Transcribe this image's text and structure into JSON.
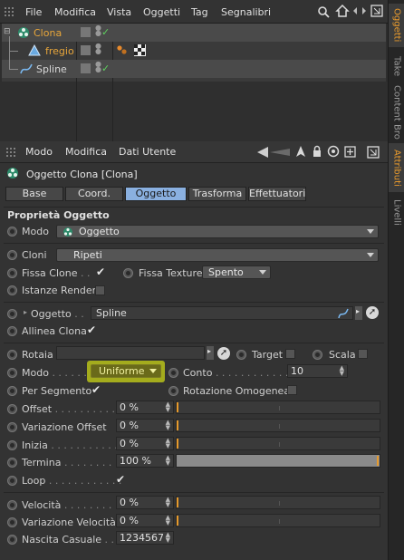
{
  "menubar": {
    "items": [
      "File",
      "Modifica",
      "Vista",
      "Oggetti",
      "Tag",
      "Segnalibri"
    ]
  },
  "objects": [
    {
      "name": "Clona",
      "color": "#e8a63a"
    },
    {
      "name": "fregio",
      "color": "#e8a63a"
    },
    {
      "name": "Spline",
      "color": "#d8d8d8"
    }
  ],
  "side_tabs": [
    "Oggetti",
    "Take",
    "Content Bro",
    "Attributi",
    "Livelli"
  ],
  "attr_menu": {
    "items": [
      "Modo",
      "Modifica",
      "Dati Utente"
    ]
  },
  "object_title": "Oggetto Clona [Clona]",
  "tabs": [
    "Base",
    "Coord.",
    "Oggetto",
    "Trasforma",
    "Effettuatori"
  ],
  "section_title": "Proprietà Oggetto",
  "props": {
    "modo_label": "Modo",
    "modo_value": "Oggetto",
    "cloni_label": "Cloni",
    "cloni_value": "Ripeti",
    "fissa_cloni_label": "Fissa Clone",
    "fissa_cloni_dots": ". .",
    "fissa_texture_label": "Fissa Texture",
    "fissa_texture_value": "Spento",
    "istanze_label": "Istanze Render",
    "oggetto_label": "Oggetto",
    "oggetto_dots": ". .",
    "oggetto_value": "Spline",
    "allinea_label": "Allinea Clona",
    "rotaia_label": "Rotaia",
    "target_label": "Target",
    "scala_label": "Scala",
    "modo2_label": "Modo",
    "modo2_dots": ". . . . . . . .",
    "modo2_value": "Uniforme",
    "conto_label": "Conto",
    "conto_dots": ". . . . . . . . . . . .",
    "conto_value": "10",
    "per_segmento_label": "Per Segmento",
    "rotazione_label": "Rotazione Omogenea",
    "offset_label": "Offset",
    "offset_dots": ". . . . . . . . . .",
    "offset_value": "0 %",
    "var_offset_label": "Variazione Offset",
    "var_offset_value": "0 %",
    "inizia_label": "Inizia",
    "inizia_dots": ". . . . . . . . . . . .",
    "inizia_value": "0 %",
    "termina_label": "Termina",
    "termina_dots": ". . . . . . . . .",
    "termina_value": "100 %",
    "loop_label": "Loop",
    "loop_dots": ". . . . . . . . . . . .",
    "velocita_label": "Velocità",
    "velocita_dots": ". . . . . . . .",
    "velocita_value": "0 %",
    "var_velocita_label": "Variazione Velocità",
    "var_velocita_value": "0 %",
    "nascita_label": "Nascita Casuale",
    "nascita_dots": ". .",
    "nascita_value": "1234567"
  },
  "colors": {
    "accent_orange": "#e8a63a",
    "tab_active": "#8ab0e0",
    "highlight_yellow": "#b8c21a"
  }
}
